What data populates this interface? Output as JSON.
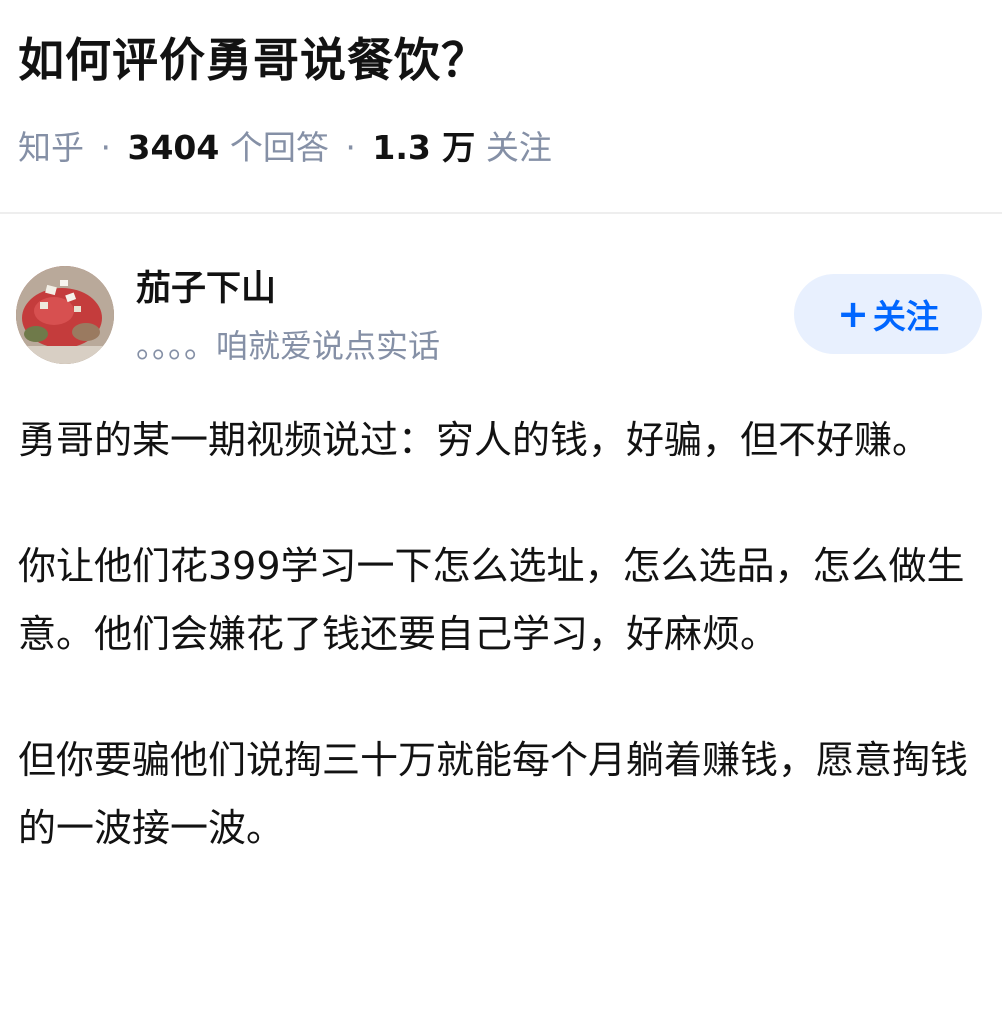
{
  "question": {
    "title": "如何评价勇哥说餐饮？",
    "source": "知乎",
    "answer_count": "3404",
    "answer_label": "个回答",
    "follower_count": "1.3 万",
    "follower_label": "关注",
    "separator": "·"
  },
  "author": {
    "name": "茄子下山",
    "bio": "。。。。咱就爱说点实话",
    "follow_icon": "plus-icon",
    "follow_label": "关注"
  },
  "answer": {
    "paragraphs": [
      "勇哥的某一期视频说过：穷人的钱，好骗，但不好赚。",
      "你让他们花399学习一下怎么选址，怎么选品，怎么做生意。他们会嫌花了钱还要自己学习，好麻烦。",
      "但你要骗他们说掏三十万就能每个月躺着赚钱，愿意掏钱的一波接一波。"
    ]
  },
  "colors": {
    "text": "#121212",
    "muted": "#8590a6",
    "accent": "#0066ff",
    "follow_bg": "#e8f0fe"
  }
}
